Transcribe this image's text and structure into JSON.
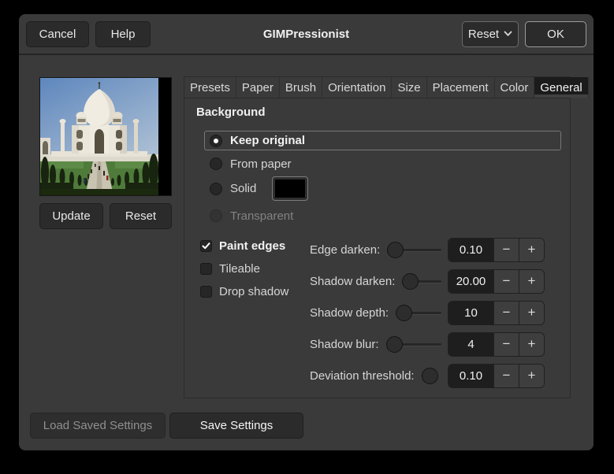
{
  "window": {
    "title": "GIMPressionist"
  },
  "header": {
    "cancel_label": "Cancel",
    "help_label": "Help",
    "reset_label": "Reset",
    "ok_label": "OK"
  },
  "preview": {
    "update_label": "Update",
    "reset_label": "Reset"
  },
  "tabs": {
    "items": [
      "Presets",
      "Paper",
      "Brush",
      "Orientation",
      "Size",
      "Placement",
      "Color",
      "General"
    ],
    "active": "General"
  },
  "general": {
    "background_title": "Background",
    "options": [
      {
        "label": "Keep original",
        "selected": true,
        "focused": true
      },
      {
        "label": "From paper",
        "selected": false
      },
      {
        "label": "Solid",
        "selected": false,
        "swatch_color": "#000000"
      },
      {
        "label": "Transparent",
        "selected": false,
        "disabled": true
      }
    ],
    "checkboxes": [
      {
        "label": "Paint edges",
        "checked": true
      },
      {
        "label": "Tileable",
        "checked": false
      },
      {
        "label": "Drop shadow",
        "checked": false
      }
    ],
    "sliders": [
      {
        "label": "Edge darken:",
        "value": "0.10"
      },
      {
        "label": "Shadow darken:",
        "value": "20.00"
      },
      {
        "label": "Shadow depth:",
        "value": "10"
      },
      {
        "label": "Shadow blur:",
        "value": "4"
      },
      {
        "label": "Deviation threshold:",
        "value": "0.10"
      }
    ],
    "spin_minus": "−",
    "spin_plus": "+"
  },
  "footer": {
    "load_label": "Load Saved Settings",
    "save_label": "Save Settings"
  },
  "colors": {
    "desktop_bg": "#000000",
    "dialog_bg": "#3a3a3a",
    "button_bg": "#2b2b2b",
    "entry_bg": "#1e1e1e",
    "active_tab_bg": "#1b1b1b",
    "text": "#e6e6e6",
    "disabled_text": "#8f8f8f",
    "ok_border": "#9c9c9c",
    "solid_swatch": "#000000"
  }
}
